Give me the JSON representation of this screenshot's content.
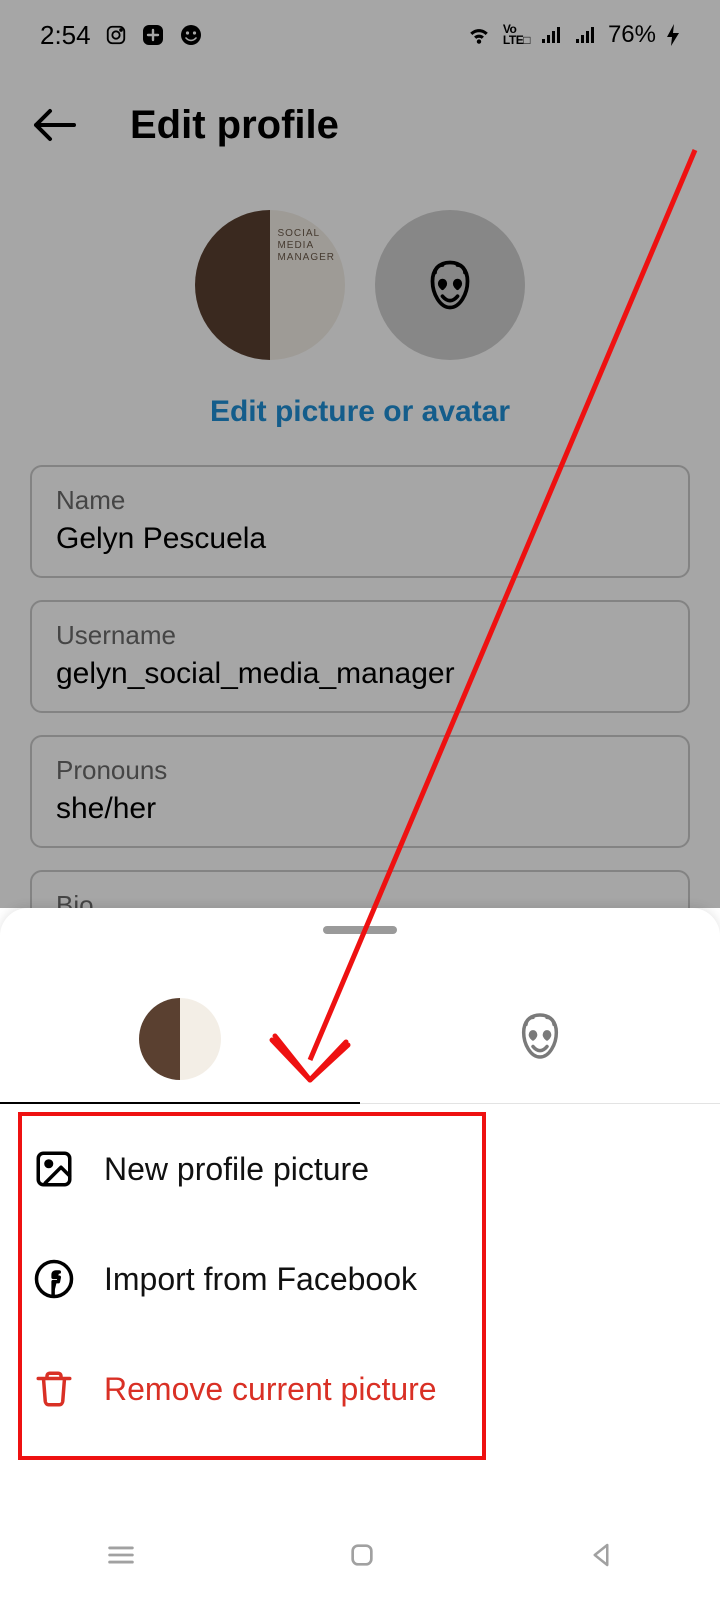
{
  "status": {
    "time": "2:54",
    "battery_text": "76%"
  },
  "header": {
    "title": "Edit profile"
  },
  "edit_link": "Edit picture or avatar",
  "fields": {
    "name": {
      "label": "Name",
      "value": "Gelyn Pescuela"
    },
    "username": {
      "label": "Username",
      "value": "gelyn_social_media_manager"
    },
    "pronouns": {
      "label": "Pronouns",
      "value": "she/her"
    },
    "bio": {
      "label": "Bio",
      "value": ""
    }
  },
  "sheet": {
    "tabs": {
      "photo": "photo",
      "avatar": "avatar"
    },
    "options": {
      "new_picture": "New profile picture",
      "import_fb": "Import from Facebook",
      "remove_picture": "Remove current picture"
    }
  }
}
